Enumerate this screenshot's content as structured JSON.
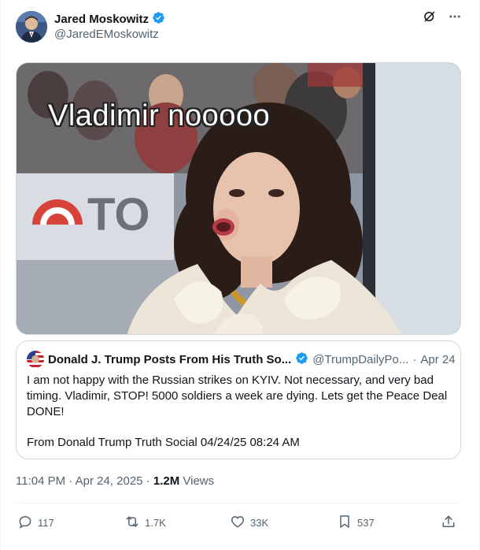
{
  "author": {
    "name": "Jared Moskowitz",
    "handle": "@JaredEMoskowitz",
    "verified_color": "#1d9bf0"
  },
  "media": {
    "caption": "Vladimir nooooo",
    "background_sign_text": "TO"
  },
  "quoted_post": {
    "name": "Donald J. Trump Posts From His Truth So...",
    "handle": "@TrumpDailyPo...",
    "separator": "·",
    "date": "Apr 24",
    "body": "I am not happy with the Russian strikes on KYIV. Not necessary, and very bad timing. Vladimir, STOP! 5000 soldiers a week are dying. Lets get the Peace Deal DONE!",
    "footer": "From Donald Trump Truth Social 04/24/25 08:24 AM"
  },
  "meta": {
    "time": "11:04 PM",
    "separator": "·",
    "date": "Apr 24, 2025",
    "separator2": "·",
    "views_count": "1.2M",
    "views_label": "Views"
  },
  "actions": {
    "replies": "117",
    "reposts": "1.7K",
    "likes": "33K",
    "bookmarks": "537"
  },
  "icons": [
    "verified-badge-icon",
    "grok-icon",
    "more-icon",
    "reply-icon",
    "repost-icon",
    "like-icon",
    "bookmark-icon",
    "share-icon"
  ]
}
